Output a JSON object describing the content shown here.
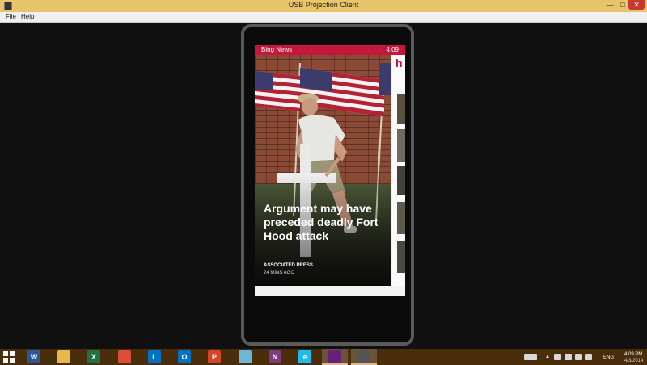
{
  "window": {
    "title": "USB Projection Client",
    "minimize_label": "—",
    "maximize_label": "□",
    "close_label": "✕"
  },
  "menu": {
    "items": [
      "File",
      "Help"
    ]
  },
  "phone": {
    "status": {
      "app": "Bing News",
      "time": "4:09"
    },
    "article": {
      "headline": "Argument may have preceded deadly Fort Hood attack",
      "source": "ASSOCIATED PRESS",
      "age": "24 MINS AGO"
    },
    "next_panel_letter": "h"
  },
  "taskbar": {
    "apps": [
      {
        "name": "word-icon",
        "letter": "W",
        "color": "#2b579a"
      },
      {
        "name": "file-explorer-icon",
        "letter": "",
        "color": "#e8b84a"
      },
      {
        "name": "excel-icon",
        "letter": "X",
        "color": "#217346"
      },
      {
        "name": "chrome-icon",
        "letter": "",
        "color": "#dd4b39"
      },
      {
        "name": "lync-icon",
        "letter": "L",
        "color": "#0072c6"
      },
      {
        "name": "outlook-icon",
        "letter": "O",
        "color": "#0072c6"
      },
      {
        "name": "powerpoint-icon",
        "letter": "P",
        "color": "#d24726"
      },
      {
        "name": "paint-icon",
        "letter": "",
        "color": "#6bb8d9"
      },
      {
        "name": "onenote-icon",
        "letter": "N",
        "color": "#80397b"
      },
      {
        "name": "internet-explorer-icon",
        "letter": "e",
        "color": "#1ebbee"
      },
      {
        "name": "visual-studio-icon",
        "letter": "",
        "color": "#68217a"
      },
      {
        "name": "phone-projection-icon",
        "letter": "",
        "color": "#555555"
      }
    ],
    "tray": {
      "language": "ENG",
      "clock_time": "4:09 PM",
      "clock_date": "4/3/2014"
    }
  },
  "colors": {
    "accent": "#c4173b",
    "titlebar": "#e8c46a",
    "taskbar": "#4a2e0c"
  }
}
